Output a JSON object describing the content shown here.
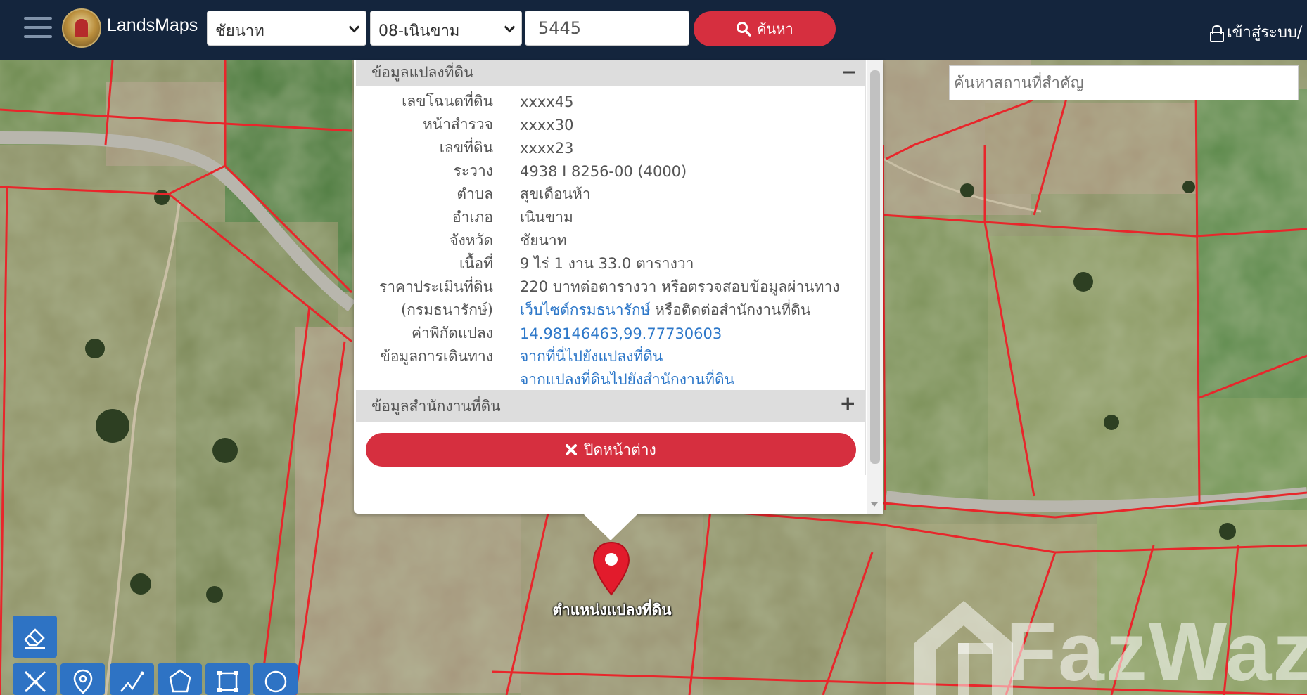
{
  "header": {
    "brand": "LandsMaps",
    "province_value": "ชัยนาท",
    "district_value": "08-เนินขาม",
    "deed_number": "5445",
    "search_label": "ค้นหา",
    "login_label": "เข้าสู่ระบบ/"
  },
  "place_search": {
    "placeholder": "ค้นหาสถานที่สำคัญ"
  },
  "popup": {
    "section_title": "ข้อมูลแปลงที่ดิน",
    "collapse_symbol": "−",
    "rows": [
      {
        "label": "เลขโฉนดที่ดิน",
        "value": "xxxx45"
      },
      {
        "label": "หน้าสำรวจ",
        "value": "xxxx30"
      },
      {
        "label": "เลขที่ดิน",
        "value": "xxxx23"
      },
      {
        "label": "ระวาง",
        "value": "4938 I 8256-00 (4000)"
      },
      {
        "label": "ตำบล",
        "value": "สุขเดือนห้า"
      },
      {
        "label": "อำเภอ",
        "value": "เนินขาม"
      },
      {
        "label": "จังหวัด",
        "value": "ชัยนาท"
      },
      {
        "label": "เนื้อที่",
        "value": "9 ไร่ 1 งาน 33.0 ตารางวา"
      }
    ],
    "price_label_1": "ราคาประเมินที่ดิน",
    "price_label_2": "(กรมธนารักษ์)",
    "price_text_1": "220 บาทต่อตารางวา หรือตรวจสอบข้อมูลผ่านทาง",
    "price_link": "เว็บไซต์กรมธนารักษ์",
    "price_text_2": " หรือติดต่อสำนักงานที่ดิน",
    "coord_label": "ค่าพิกัดแปลง",
    "coord_value": "14.98146463,99.77730603",
    "travel_label": "ข้อมูลการเดินทาง",
    "travel_link_1": "จากที่นี่ไปยังแปลงที่ดิน",
    "travel_link_2": "จากแปลงที่ดินไปยังสำนักงานที่ดิน",
    "office_title": "ข้อมูลสำนักงานที่ดิน",
    "expand_symbol": "+",
    "close_label": "ปิดหน้าต่าง"
  },
  "marker": {
    "label": "ตำแหน่งแปลงที่ดิน"
  },
  "toolbar": {
    "icons": [
      "eraser-icon",
      "ruler-icon",
      "point-marker-icon",
      "line-measure-icon",
      "polygon-icon",
      "rectangle-icon",
      "circle-icon"
    ]
  },
  "watermark": {
    "text": "FazWaz"
  },
  "colors": {
    "topbar": "#14253d",
    "accent_red": "#d62f3f",
    "link_blue": "#2e78c9",
    "tool_blue": "#2e73c4",
    "parcel_line": "#e8262b"
  }
}
